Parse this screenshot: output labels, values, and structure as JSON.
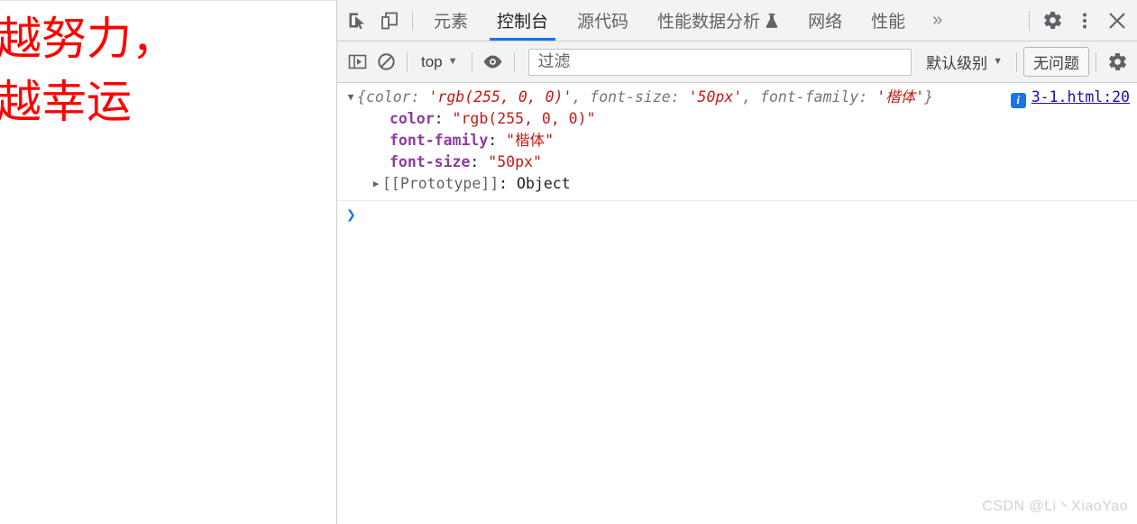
{
  "page": {
    "text_lines": [
      "越努力，",
      "越幸运"
    ],
    "text_color": "#ff0000",
    "font_size": "50px",
    "font_family": "楷体"
  },
  "devtools": {
    "toolbar_icons": {
      "inspect": "inspect-element-icon",
      "device": "device-toolbar-icon"
    },
    "tabs": [
      {
        "label": "元素",
        "active": false
      },
      {
        "label": "控制台",
        "active": true
      },
      {
        "label": "源代码",
        "active": false
      },
      {
        "label": "性能数据分析",
        "active": false,
        "badge": "flask-icon"
      },
      {
        "label": "网络",
        "active": false
      },
      {
        "label": "性能",
        "active": false
      }
    ],
    "overflow_label": "»",
    "right_icons": {
      "settings": "gear-icon",
      "more": "kebab-menu-icon",
      "close": "close-icon"
    }
  },
  "console_toolbar": {
    "sidebar_toggle": "console-sidebar-icon",
    "clear_console": "clear-console-icon",
    "context_selector": "top",
    "eye_icon": "eye-icon",
    "filter": {
      "value": "",
      "placeholder": "过滤"
    },
    "level_selector": "默认级别",
    "issues_label": "无问题",
    "settings_icon": "gear-icon"
  },
  "console_output": {
    "preview": {
      "open_brace": "{",
      "seg1_key": "color: ",
      "seg1_val": "'rgb(255, 0, 0)'",
      "seg2_key": ", font-size: ",
      "seg2_val": "'50px'",
      "seg3_key": ", font-family: ",
      "seg3_val": "'楷体'",
      "close_brace": "}"
    },
    "source_link": "3-1.html:20",
    "properties": [
      {
        "name": "color",
        "value": "\"rgb(255, 0, 0)\""
      },
      {
        "name": "font-family",
        "value": "\"楷体\""
      },
      {
        "name": "font-size",
        "value": "\"50px\""
      }
    ],
    "prototype": {
      "name": "[[Prototype]]",
      "value": "Object"
    },
    "prompt_caret": "❯"
  },
  "watermark": "CSDN @Li丶XiaoYao"
}
